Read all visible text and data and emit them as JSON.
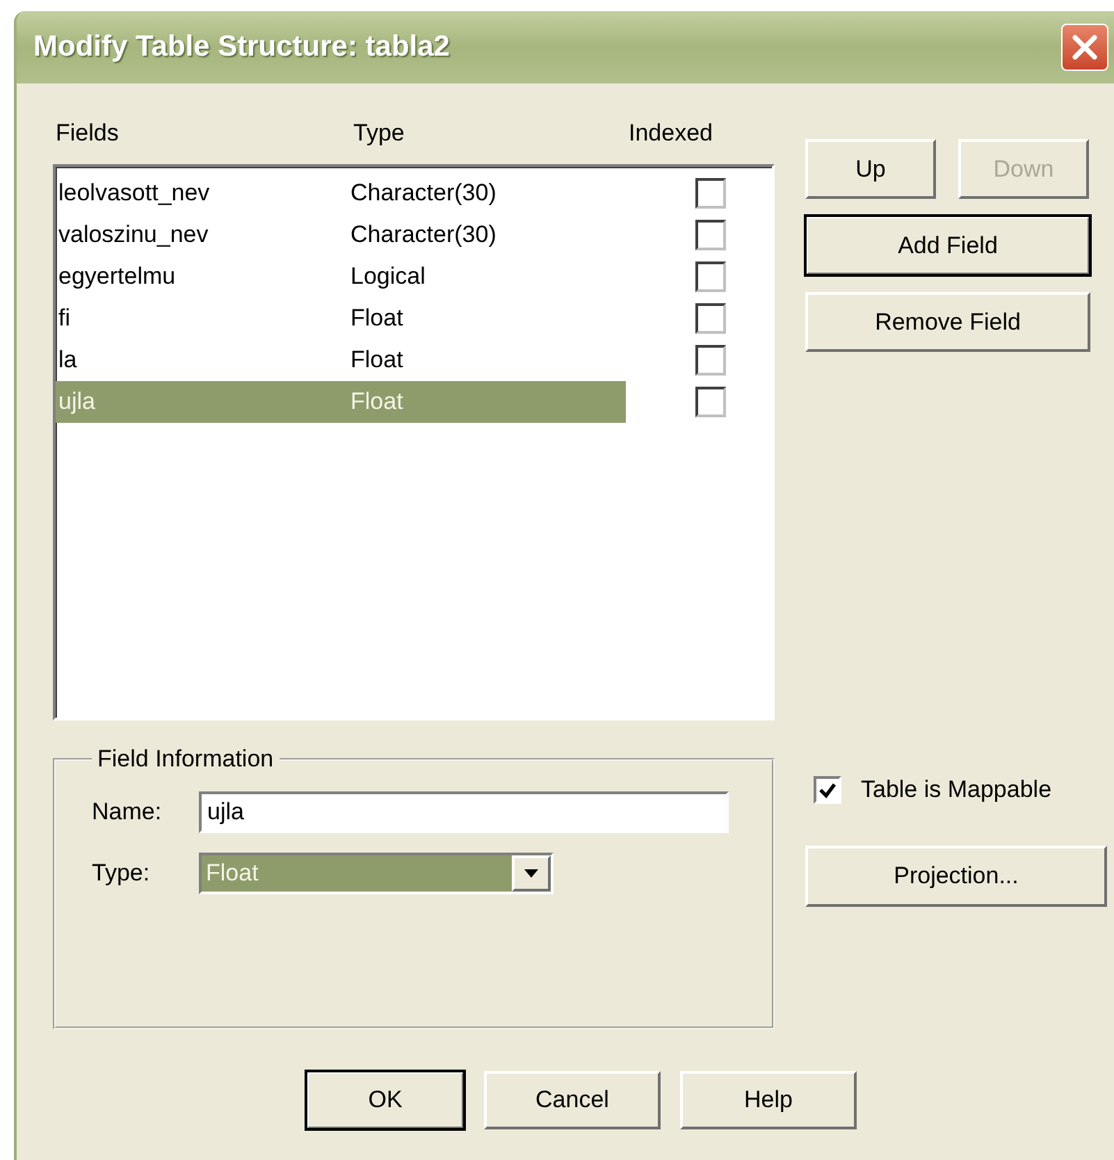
{
  "window": {
    "title": "Modify Table Structure: tabla2"
  },
  "columns": [
    "Fields",
    "Type",
    "Indexed"
  ],
  "fields": [
    {
      "name": "leolvasott_nev",
      "type": "Character(30)",
      "indexed": false,
      "selected": false
    },
    {
      "name": "valoszinu_nev",
      "type": "Character(30)",
      "indexed": false,
      "selected": false
    },
    {
      "name": "egyertelmu",
      "type": "Logical",
      "indexed": false,
      "selected": false
    },
    {
      "name": "fi",
      "type": "Float",
      "indexed": false,
      "selected": false
    },
    {
      "name": "la",
      "type": "Float",
      "indexed": false,
      "selected": false
    },
    {
      "name": "ujla",
      "type": "Float",
      "indexed": false,
      "selected": true
    }
  ],
  "side_buttons": [
    {
      "label": "Up",
      "disabled": false,
      "default": false
    },
    {
      "label": "Down",
      "disabled": true,
      "default": false
    },
    {
      "label": "Add Field",
      "disabled": false,
      "default": true
    },
    {
      "label": "Remove Field",
      "disabled": false,
      "default": false
    }
  ],
  "field_information": {
    "title": "Field Information",
    "name_label": "Name:",
    "name_value": "ujla",
    "type_label": "Type:",
    "type_value": "Float"
  },
  "mappable": {
    "label": "Table is Mappable",
    "checked": true
  },
  "projection_button": "Projection...",
  "buttons": [
    {
      "label": "OK",
      "default": true
    },
    {
      "label": "Cancel",
      "default": false
    },
    {
      "label": "Help",
      "default": false
    }
  ]
}
